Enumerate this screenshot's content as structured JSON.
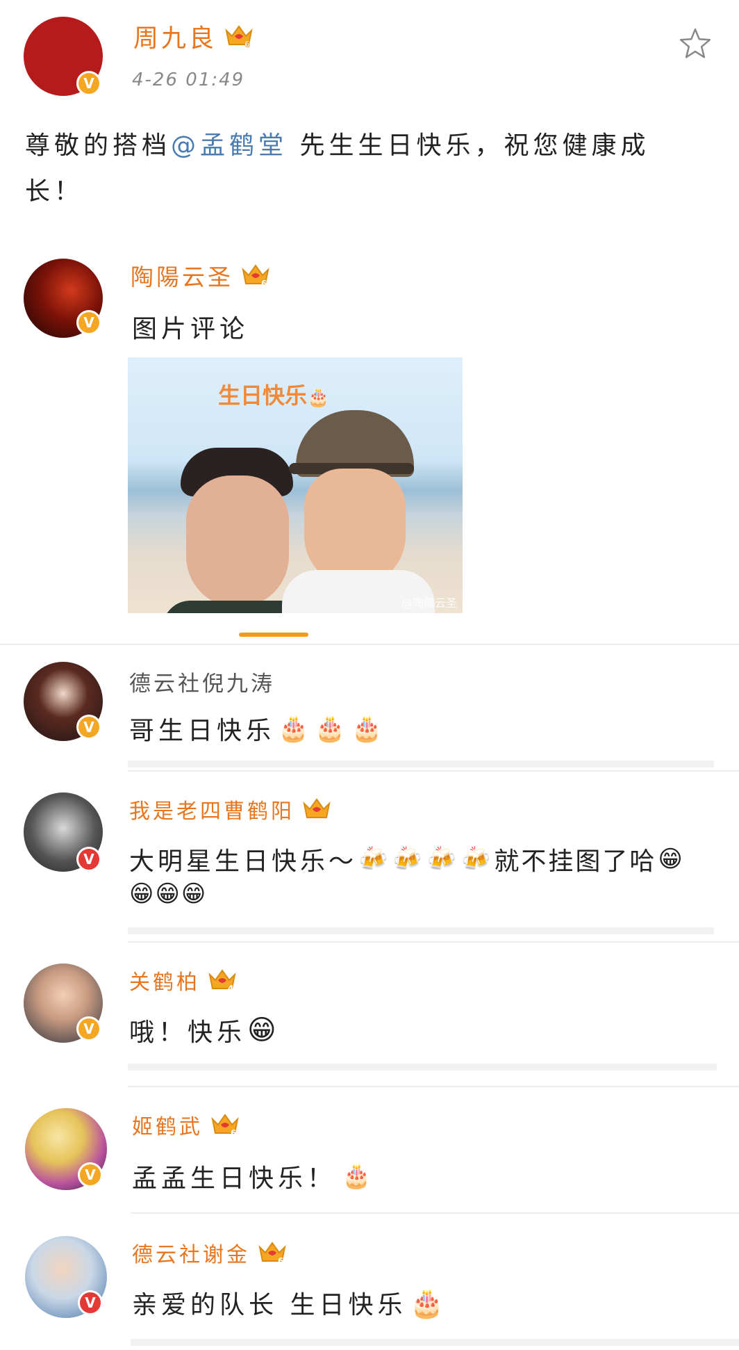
{
  "post": {
    "author": "周九良",
    "level": "6",
    "time": "4-26 01:49",
    "text_prefix": "尊敬的搭档",
    "mention": "@孟鹤堂",
    "text_suffix": " 先生生日快乐，祝您健康成",
    "text_line2": "长！"
  },
  "reply": {
    "author": "陶陽云圣",
    "level": "6",
    "text": "图片评论",
    "image_caption": "生日快乐",
    "watermark": "@陶陽云圣"
  },
  "comments": [
    {
      "name": "德云社倪九涛",
      "name_style": "gray",
      "text": "哥生日快乐",
      "emojis": [
        "cake",
        "cake",
        "cake"
      ]
    },
    {
      "name": "我是老四曹鹤阳",
      "name_style": "orange",
      "level": "6",
      "text_a": "大明星生日快乐～",
      "text_b": "就不挂图了哈",
      "emojis_mid": [
        "beer",
        "beer",
        "beer",
        "beer"
      ],
      "emojis_end": [
        "grin",
        "grin",
        "grin",
        "grin"
      ]
    },
    {
      "name": "关鹤柏",
      "name_style": "orange",
      "level": "4",
      "text": "哦！快乐",
      "emojis": [
        "big-grin"
      ]
    },
    {
      "name": "姬鹤武",
      "name_style": "orange",
      "level": "6",
      "text": "孟孟生日快乐！",
      "emojis": [
        "cake"
      ]
    },
    {
      "name": "德云社谢金",
      "name_style": "orange",
      "level": "6",
      "text": "亲爱的队长 生日快乐",
      "emojis": [
        "birthday-cake"
      ]
    }
  ],
  "badge_letter": "V",
  "colors": {
    "accent": "#e7761f",
    "mention": "#4a7bb0",
    "vip": "#f5a623"
  }
}
